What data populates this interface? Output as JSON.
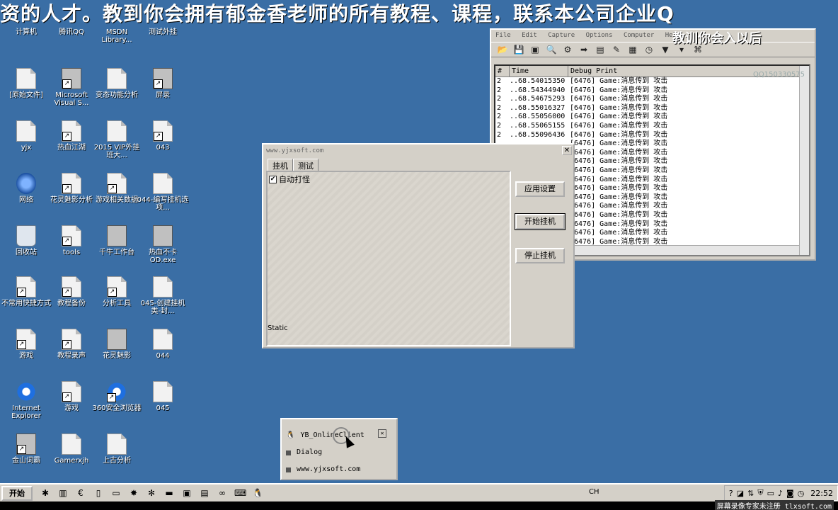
{
  "banner": "资的人才。教到你会拥有郁金香老师的所有教程、课程，联系本公司企业Q",
  "desktop_icons": [
    {
      "label": "计算机"
    },
    {
      "label": "腾讯QQ"
    },
    {
      "label": "MSDN Library..."
    },
    {
      "label": "测试外挂"
    },
    {
      "label": "[原始文件]"
    },
    {
      "label": "Microsoft Visual S..."
    },
    {
      "label": "变态功能分析"
    },
    {
      "label": "屏录"
    },
    {
      "label": "yjx"
    },
    {
      "label": "热血江湖"
    },
    {
      "label": "2015 VIP外挂班大..."
    },
    {
      "label": "043"
    },
    {
      "label": "网络"
    },
    {
      "label": "花灵魅影分析"
    },
    {
      "label": "游戏相关数据"
    },
    {
      "label": "044-编写挂机选项..."
    },
    {
      "label": "回收站"
    },
    {
      "label": "tools"
    },
    {
      "label": "千牛工作台"
    },
    {
      "label": "热血不卡OD.exe"
    },
    {
      "label": "不常用快捷方式"
    },
    {
      "label": "教程备份"
    },
    {
      "label": "分析工具"
    },
    {
      "label": "045-创建挂机类-封..."
    },
    {
      "label": "游戏"
    },
    {
      "label": "教程录声"
    },
    {
      "label": "花灵魅影"
    },
    {
      "label": "044"
    },
    {
      "label": "Internet Explorer"
    },
    {
      "label": "游戏"
    },
    {
      "label": "360安全浏览器"
    },
    {
      "label": "045"
    },
    {
      "label": "金山词霸"
    },
    {
      "label": "Gamerxjh"
    },
    {
      "label": "上古分析"
    }
  ],
  "debugview": {
    "menu": [
      "File",
      "Edit",
      "Capture",
      "Options",
      "Computer",
      "Help"
    ],
    "watermark": "QQ150330575",
    "overlay_title": "教训你会入以后",
    "columns": [
      "#",
      "Time",
      "Debug Print"
    ],
    "rows": [
      {
        "n": "2",
        "time": "..68.54015350",
        "msg": "[6476] Game:消息传到  攻击"
      },
      {
        "n": "2",
        "time": "..68.54344940",
        "msg": "[6476] Game:消息传到  攻击"
      },
      {
        "n": "2",
        "time": "..68.54675293",
        "msg": "[6476] Game:消息传到  攻击"
      },
      {
        "n": "2",
        "time": "..68.55016327",
        "msg": "[6476] Game:消息传到  攻击"
      },
      {
        "n": "2",
        "time": "..68.55056000",
        "msg": "[6476] Game:消息传到  攻击"
      },
      {
        "n": "2",
        "time": "..68.55065155",
        "msg": "[6476] Game:消息传到  攻击"
      },
      {
        "n": "2",
        "time": "..68.55096436",
        "msg": "[6476] Game:消息传到  攻击"
      },
      {
        "n": "",
        "time": "",
        "msg": "[6476] Game:消息传到  攻击"
      },
      {
        "n": "",
        "time": "",
        "msg": "[6476] Game:消息传到  攻击"
      },
      {
        "n": "",
        "time": "",
        "msg": "[6476] Game:消息传到  攻击"
      },
      {
        "n": "",
        "time": "",
        "msg": "[6476] Game:消息传到  攻击"
      },
      {
        "n": "",
        "time": "",
        "msg": "[6476] Game:消息传到  攻击"
      },
      {
        "n": "",
        "time": "",
        "msg": "[6476] Game:消息传到  攻击"
      },
      {
        "n": "",
        "time": "",
        "msg": "[6476] Game:消息传到  攻击"
      },
      {
        "n": "",
        "time": "",
        "msg": "[6476] Game:消息传到  攻击"
      },
      {
        "n": "",
        "time": "",
        "msg": "[6476] Game:消息传到  攻击"
      },
      {
        "n": "",
        "time": "",
        "msg": "[6476] Game:消息传到  攻击"
      },
      {
        "n": "",
        "time": "",
        "msg": "[6476] Game:消息传到  攻击"
      },
      {
        "n": "",
        "time": "",
        "msg": "[6476] Game:消息传到  攻击"
      },
      {
        "n": "",
        "time": "",
        "msg": "[6476] Game:消息传到  攻击"
      }
    ]
  },
  "dialog": {
    "title": "www.yjxsoft.com",
    "tabs": [
      "挂机",
      "测试"
    ],
    "checkbox_label": "自动打怪",
    "checkbox_checked": "✔",
    "static_label": "Static",
    "buttons": {
      "apply": "应用设置",
      "start": "开始挂机",
      "stop": "停止挂机"
    },
    "close": "✕"
  },
  "popup": {
    "items": [
      "YB_OnlineClient",
      "Dialog",
      "www.yjxsoft.com"
    ]
  },
  "taskbar": {
    "start": "开始",
    "lang": "CH",
    "clock": "22:52"
  },
  "stamp": "屏幕录像专家未注册 tlxsoft.com"
}
